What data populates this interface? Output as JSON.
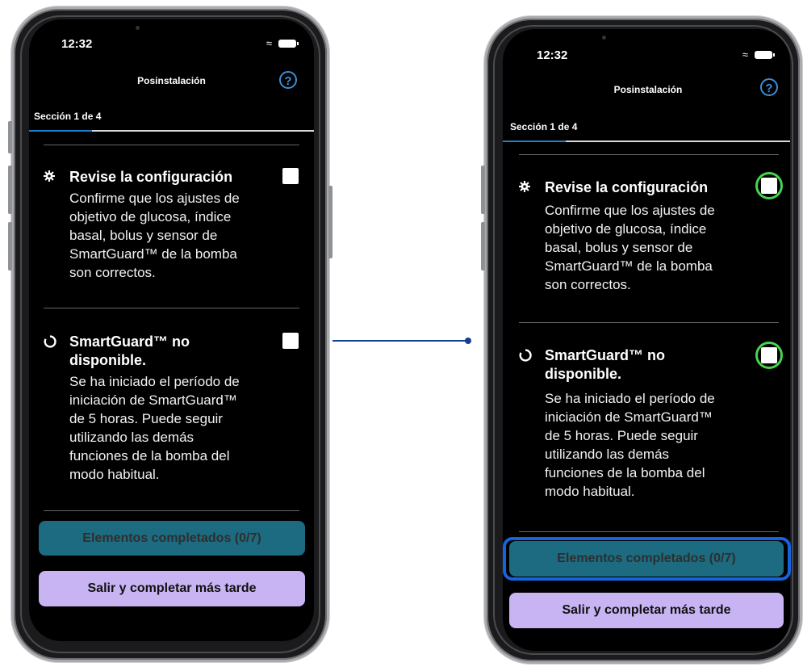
{
  "status_bar": {
    "time": "12:32",
    "wifi_icon": "wifi-icon",
    "battery_icon": "battery-icon"
  },
  "header": {
    "title": "Posinstalación",
    "help_icon": "question-mark-icon"
  },
  "section": {
    "label": "Sección 1 de 4",
    "progress_fraction": 0.22
  },
  "items": [
    {
      "icon": "gear-icon",
      "title": "Revise la configuración",
      "body_lines": [
        "Confirme que los ajustes de",
        "objetivo de glucosa, índice",
        "basal, bolus y sensor de",
        "SmartGuard™ de la bomba",
        "son correctos."
      ],
      "checked": false
    },
    {
      "icon": "loading-ring-icon",
      "title_lines": [
        "SmartGuard™ no",
        "disponible."
      ],
      "body_lines": [
        "Se ha iniciado el período de",
        "iniciación de SmartGuard™",
        "de 5 horas. Puede seguir",
        "utilizando las demás",
        "funciones de la bomba del",
        "modo habitual."
      ],
      "checked": false
    }
  ],
  "buttons": {
    "completed": "Elementos completados (0/7)",
    "exit": "Salir y completar más tarde"
  },
  "colors": {
    "progress": "#1e80c8",
    "completed_button": "#1d6b80",
    "exit_button": "#c8b3f3",
    "highlight_ring": "#46d44c",
    "highlight_box": "#1463e0",
    "connector": "#123f94"
  }
}
